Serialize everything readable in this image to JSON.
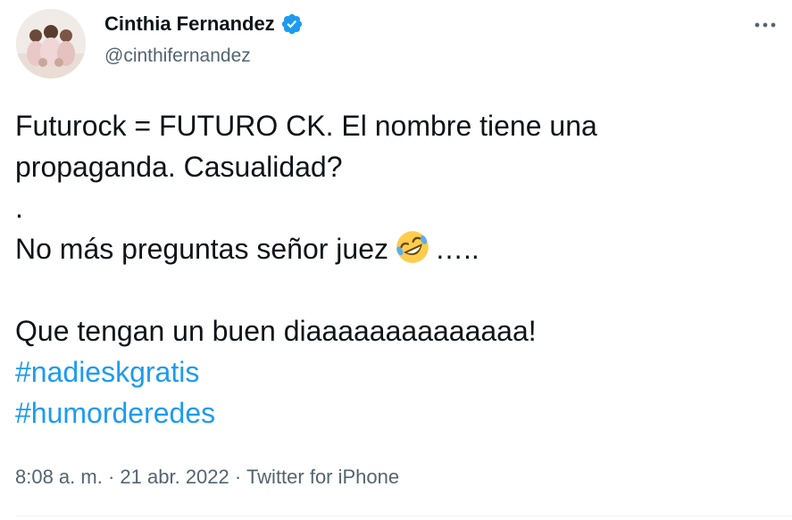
{
  "author": {
    "display_name": "Cinthia Fernandez",
    "handle": "@cinthifernandez",
    "verified": true,
    "avatar_icon": "profile-photo"
  },
  "menu": {
    "icon": "more-horizontal-icon"
  },
  "tweet": {
    "lines": [
      "Futurock = FUTURO CK. El nombre tiene una",
      "propaganda. Casualidad?",
      ".",
      "No más preguntas señor juez",
      "",
      "Que tengan un buen diaaaaaaaaaaaaaa!"
    ],
    "line4_suffix": "…..",
    "emoji": "rolling-on-the-floor-laughing-emoji",
    "hashtags": [
      "#nadieskgratis",
      "#humorderedes"
    ]
  },
  "meta": {
    "time": "8:08 a. m.",
    "separator": "·",
    "date": "21 abr. 2022",
    "source": "Twitter for iPhone"
  },
  "colors": {
    "text": "#0f1419",
    "secondary": "#536471",
    "link": "#1d9bf0",
    "verified": "#1d9bf0"
  }
}
